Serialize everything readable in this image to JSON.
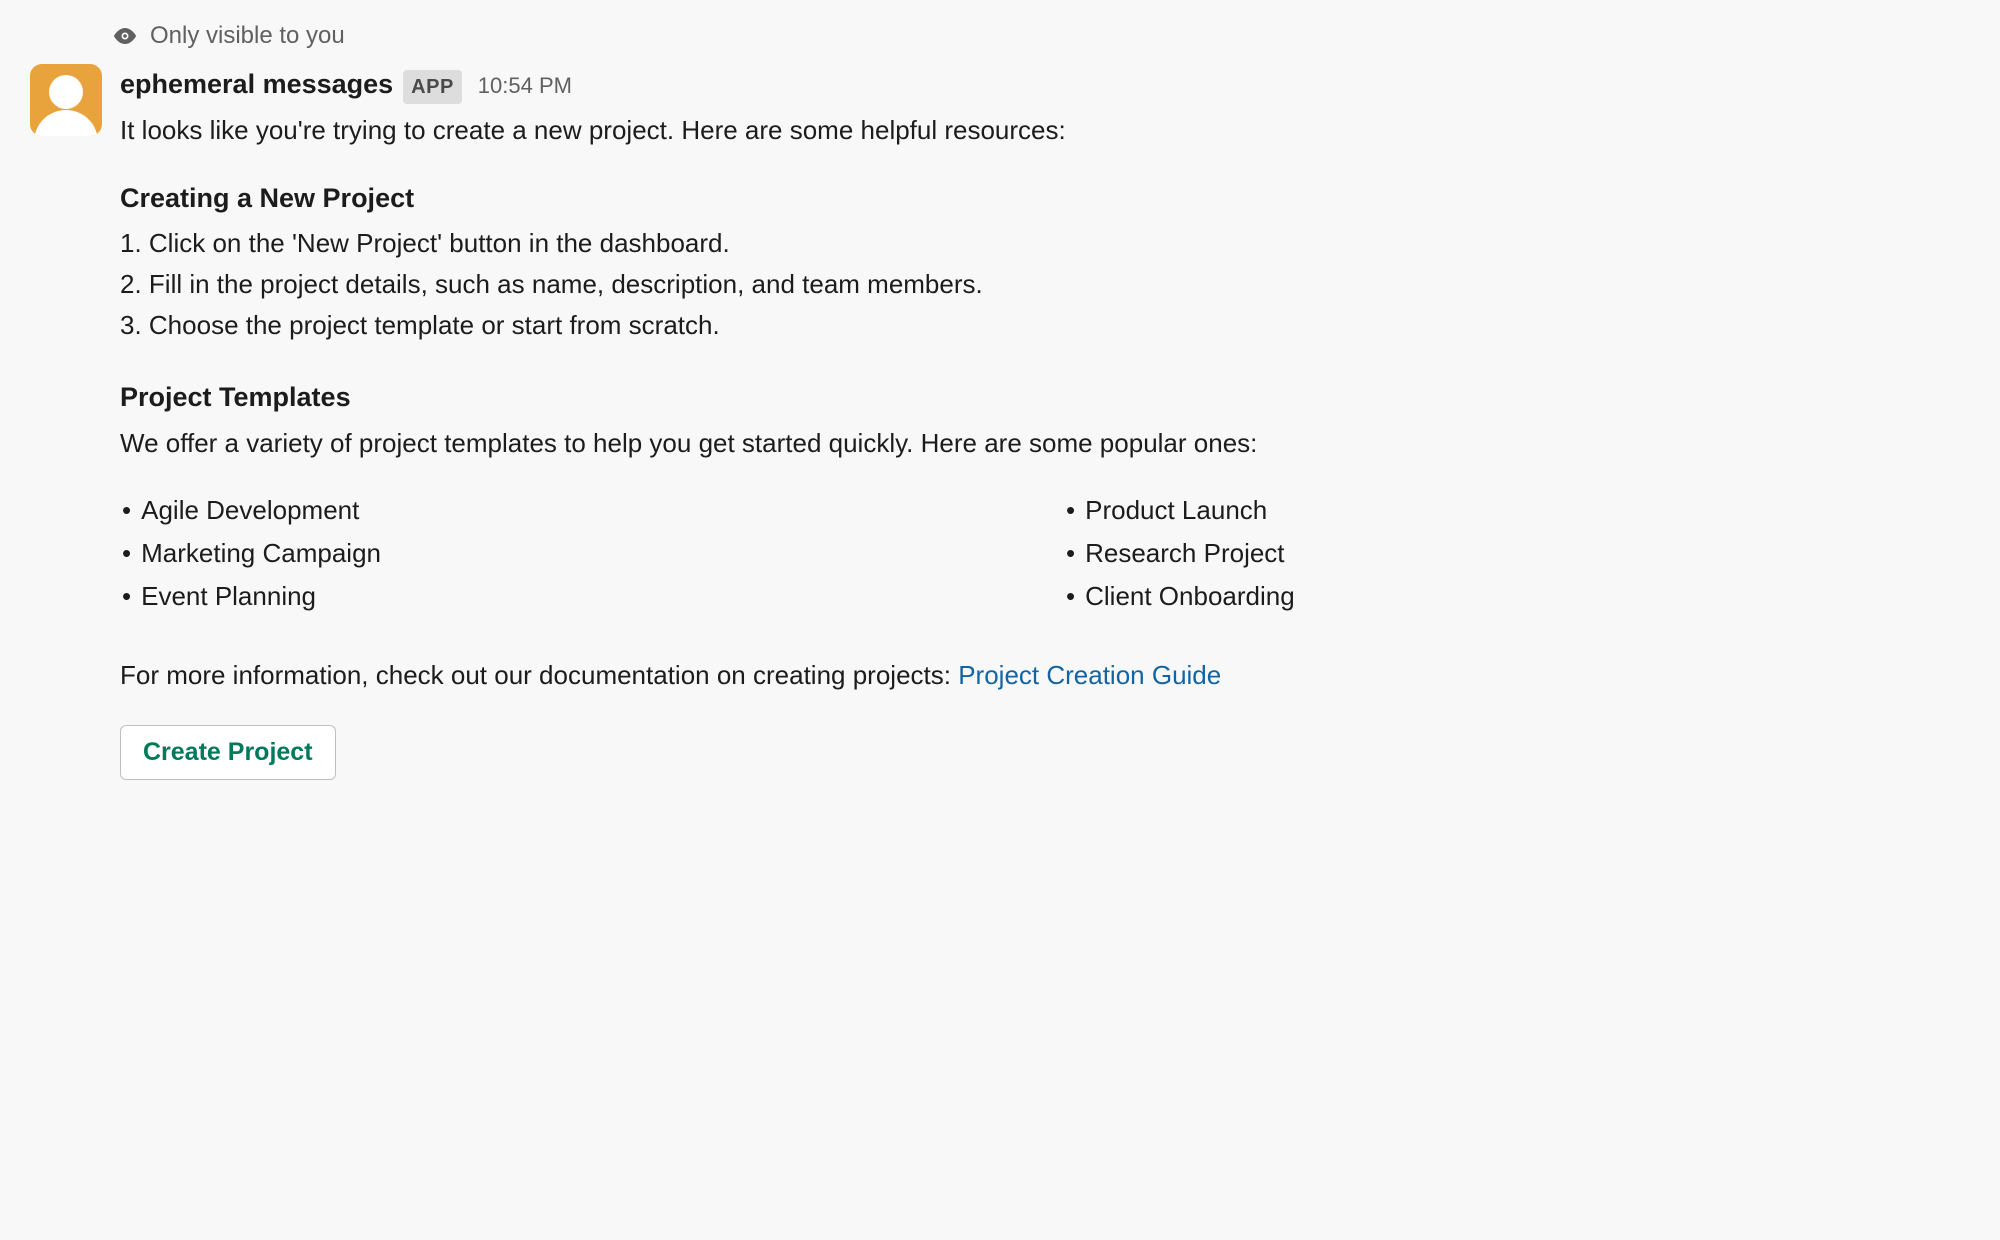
{
  "ephemeral_notice": "Only visible to you",
  "sender": {
    "name": "ephemeral messages",
    "badge": "APP",
    "timestamp": "10:54 PM"
  },
  "intro": "It looks like you're trying to create a new project. Here are some helpful resources:",
  "section1": {
    "heading": "Creating a New Project",
    "steps": [
      "1. Click on the 'New Project' button in the dashboard.",
      "2. Fill in the project details, such as name, description, and team members.",
      "3. Choose the project template or start from scratch."
    ]
  },
  "section2": {
    "heading": "Project Templates",
    "intro": "We offer a variety of project templates to help you get started quickly. Here are some popular ones:",
    "templates_col1": [
      "Agile Development",
      "Marketing Campaign",
      "Event Planning"
    ],
    "templates_col2": [
      "Product Launch",
      "Research Project",
      "Client Onboarding"
    ]
  },
  "more_info": {
    "prefix": "For more information, check out our documentation on creating projects: ",
    "link_text": "Project Creation Guide"
  },
  "button": {
    "label": "Create Project"
  }
}
